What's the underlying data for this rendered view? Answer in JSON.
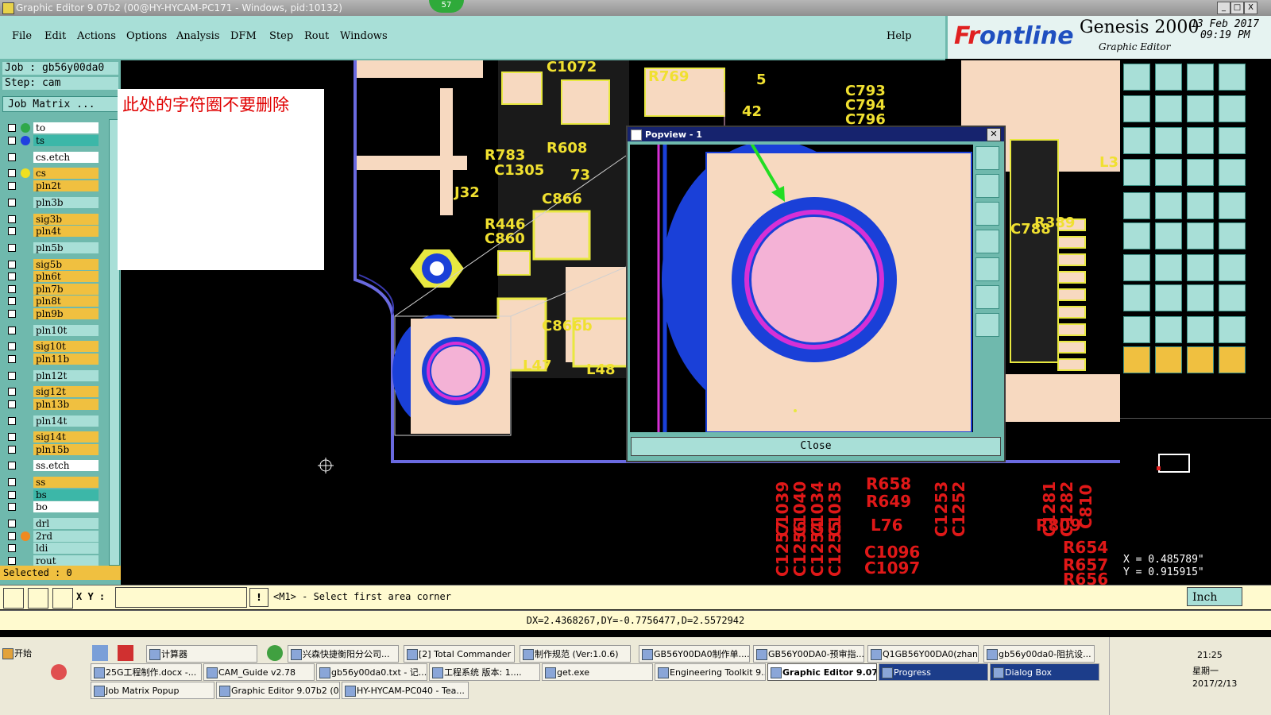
{
  "window": {
    "title": "Graphic Editor 9.07b2 (00@HY-HYCAM-PC171 - Windows, pid:10132)",
    "badge": "57",
    "minimize": "_",
    "maximize": "□",
    "close": "X"
  },
  "menu": [
    "File",
    "Edit",
    "Actions",
    "Options",
    "Analysis",
    "DFM",
    "Step",
    "Rout",
    "Windows"
  ],
  "help": "Help",
  "logo": {
    "brand_a": "Fr",
    "brand_b": "ntline",
    "product": "Genesis 2000",
    "subtitle": "Graphic Editor",
    "date": "13 Feb 2017",
    "time": "09:19 PM"
  },
  "job": {
    "job_label": "Job : gb56y00da0",
    "step_label": "Step: cam",
    "matrix_button": "Job Matrix ..."
  },
  "note_text": "此处的字符圈不要删除",
  "layers": [
    {
      "name": "to",
      "color": "#ffffff",
      "dot": "#2fa84a"
    },
    {
      "name": "ts",
      "color": "#3cb7a8",
      "dot": "#2040e0"
    },
    {
      "name": "cs.etch",
      "color": "#ffffff",
      "dot": ""
    },
    {
      "name": "cs",
      "color": "#f0c040",
      "dot": "#f0e020"
    },
    {
      "name": "pln2t",
      "color": "#f0c040",
      "dot": ""
    },
    {
      "name": "pln3b",
      "color": "#a8dfd7",
      "dot": ""
    },
    {
      "name": "sig3b",
      "color": "#f0c040",
      "dot": ""
    },
    {
      "name": "pln4t",
      "color": "#f0c040",
      "dot": ""
    },
    {
      "name": "pln5b",
      "color": "#a8dfd7",
      "dot": ""
    },
    {
      "name": "sig5b",
      "color": "#f0c040",
      "dot": ""
    },
    {
      "name": "pln6t",
      "color": "#f0c040",
      "dot": ""
    },
    {
      "name": "pln7b",
      "color": "#f0c040",
      "dot": ""
    },
    {
      "name": "pln8t",
      "color": "#f0c040",
      "dot": ""
    },
    {
      "name": "pln9b",
      "color": "#f0c040",
      "dot": ""
    },
    {
      "name": "pln10t",
      "color": "#a8dfd7",
      "dot": ""
    },
    {
      "name": "sig10t",
      "color": "#f0c040",
      "dot": ""
    },
    {
      "name": "pln11b",
      "color": "#f0c040",
      "dot": ""
    },
    {
      "name": "pln12t",
      "color": "#a8dfd7",
      "dot": ""
    },
    {
      "name": "sig12t",
      "color": "#f0c040",
      "dot": ""
    },
    {
      "name": "pln13b",
      "color": "#f0c040",
      "dot": ""
    },
    {
      "name": "pln14t",
      "color": "#a8dfd7",
      "dot": ""
    },
    {
      "name": "sig14t",
      "color": "#f0c040",
      "dot": ""
    },
    {
      "name": "pln15b",
      "color": "#f0c040",
      "dot": ""
    },
    {
      "name": "ss.etch",
      "color": "#ffffff",
      "dot": ""
    },
    {
      "name": "ss",
      "color": "#f0c040",
      "dot": ""
    },
    {
      "name": "bs",
      "color": "#3cb7a8",
      "dot": ""
    },
    {
      "name": "bo",
      "color": "#ffffff",
      "dot": ""
    },
    {
      "name": "drl",
      "color": "#a8dfd7",
      "dot": ""
    },
    {
      "name": "2rd",
      "color": "#a8dfd7",
      "dot": "#f08a20"
    },
    {
      "name": "ldi",
      "color": "#a8dfd7",
      "dot": ""
    },
    {
      "name": "rout",
      "color": "#a8dfd7",
      "dot": ""
    }
  ],
  "selected_label": "Selected : 0",
  "popview": {
    "title": "Popview - 1",
    "close_label": "Close"
  },
  "pcb_labels": {
    "top": [
      "C1072",
      "R769",
      "R783",
      "R608",
      "C1305",
      "J32",
      "C866",
      "R446",
      "C860",
      "C793",
      "C794",
      "C796",
      "R389",
      "C788",
      "L3",
      "73",
      "42",
      "5",
      "L47",
      "L48",
      "C866b"
    ],
    "red": [
      "C1039",
      "C1040",
      "C1034",
      "C1035",
      "C1257",
      "C1256",
      "C1254",
      "C1255",
      "R658",
      "R649",
      "L76",
      "C1096",
      "C1097",
      "C1253",
      "C1252",
      "C1281",
      "C1282",
      "C810",
      "R809",
      "R654",
      "R657",
      "R656"
    ]
  },
  "coords": {
    "x": "X = 0.485789\"",
    "y": "Y = 0.915915\""
  },
  "cmd": {
    "xy_label": "X Y :",
    "message": "<M1> - Select first area corner",
    "unit": "Inch",
    "warn": "!"
  },
  "distance": "DX=2.4368267,DY=-0.7756477,D=2.5572942",
  "taskbar": {
    "start": "开始",
    "row1": [
      "计算器",
      "兴森快捷衡阳分公司...",
      "[2] Total Commander ...",
      "制作规范 (Ver:1.0.6)",
      "GB56Y00DA0制作单....",
      "GB56Y00DA0-预审指...",
      "Q1GB56Y00DA0(zhan...",
      "gb56y00da0-阻抗设..."
    ],
    "row2": [
      "25G工程制作.docx -...",
      "CAM_Guide v2.78",
      "gb56y00da0.txt - 记...",
      "工程系统  版本: 1....",
      "get.exe",
      "Engineering Toolkit 9....",
      "Graphic Editor 9.07...",
      "Progress",
      "Dialog Box"
    ],
    "row3": [
      "Job Matrix Popup",
      "Graphic Editor 9.07b2 (0...",
      "HY-HYCAM-PC040 - Tea..."
    ],
    "clock": "21:25",
    "weekday": "星期一",
    "date": "2017/2/13"
  }
}
